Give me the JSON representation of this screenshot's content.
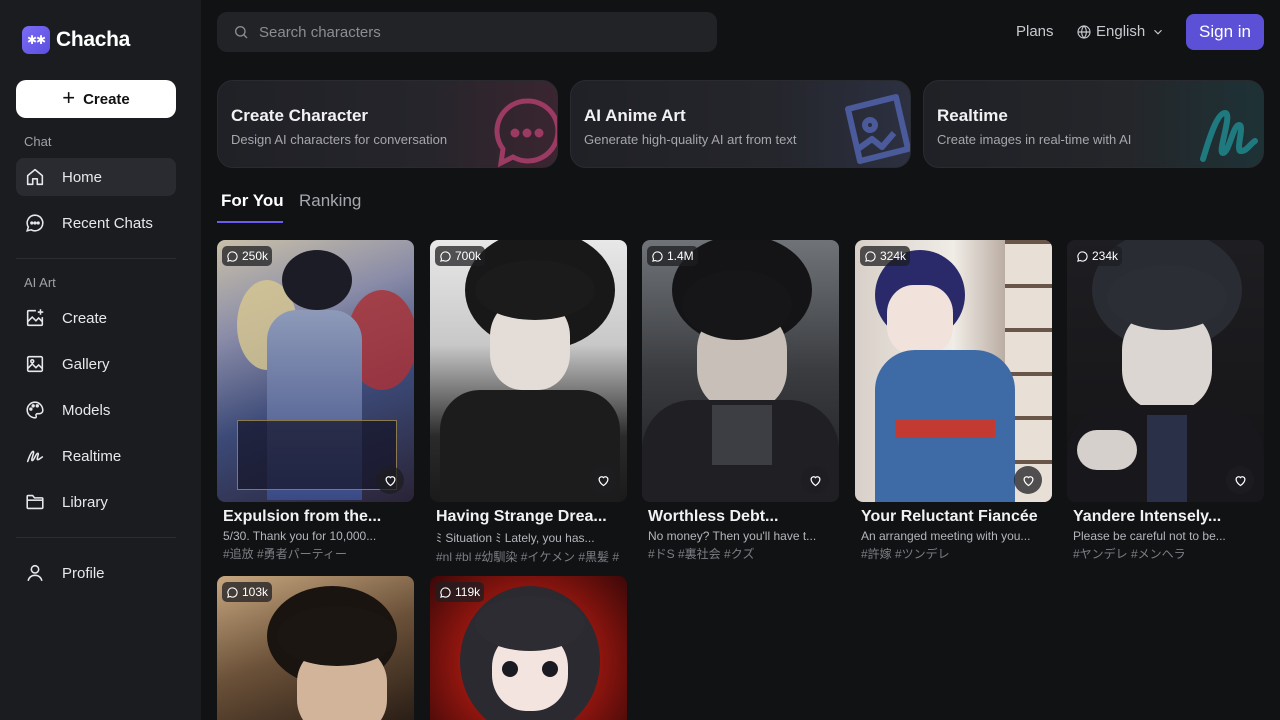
{
  "app": {
    "name": "Chacha",
    "logo_glyph": "✱✱"
  },
  "sidebar": {
    "create_label": "Create",
    "chat_section": "Chat",
    "chat_items": [
      {
        "label": "Home",
        "icon": "home-icon",
        "active": true
      },
      {
        "label": "Recent Chats",
        "icon": "chat-bubble-icon"
      }
    ],
    "art_section": "AI Art",
    "art_items": [
      {
        "label": "Create",
        "icon": "image-plus-icon"
      },
      {
        "label": "Gallery",
        "icon": "image-icon"
      },
      {
        "label": "Models",
        "icon": "palette-icon"
      },
      {
        "label": "Realtime",
        "icon": "squiggle-icon"
      },
      {
        "label": "Library",
        "icon": "folder-icon"
      }
    ],
    "profile_label": "Profile"
  },
  "header": {
    "search_placeholder": "Search characters",
    "plans_label": "Plans",
    "language_label": "English",
    "signin_label": "Sign in"
  },
  "features": [
    {
      "title": "Create Character",
      "subtitle": "Design AI characters for conversation"
    },
    {
      "title": "AI Anime Art",
      "subtitle": "Generate high-quality AI art from text"
    },
    {
      "title": "Realtime",
      "subtitle": "Create images in real-time with AI"
    }
  ],
  "tabs": [
    {
      "label": "For You",
      "active": true
    },
    {
      "label": "Ranking",
      "active": false
    }
  ],
  "cards": [
    {
      "count": "250k",
      "title": "Expulsion from the...",
      "desc": "5/30. Thank you for 10,000...",
      "tags": "#追放 #勇者パーティー"
    },
    {
      "count": "700k",
      "title": "Having Strange Drea...",
      "desc": "ﾐ Situation ﾐ Lately, you has...",
      "tags": "#nl #bl #幼馴染 #イケメン #黒髪 #"
    },
    {
      "count": "1.4M",
      "title": "Worthless Debt...",
      "desc": "No money? Then you'll have t...",
      "tags": "#ドS #裏社会 #クズ"
    },
    {
      "count": "324k",
      "title": "Your Reluctant Fiancée",
      "desc": "An arranged meeting with you...",
      "tags": "#許嫁 #ツンデレ"
    },
    {
      "count": "234k",
      "title": "Yandere Intensely...",
      "desc": "Please be careful not to be...",
      "tags": "#ヤンデレ #メンヘラ"
    },
    {
      "count": "103k",
      "title": "",
      "desc": "",
      "tags": ""
    },
    {
      "count": "119k",
      "title": "",
      "desc": "",
      "tags": ""
    }
  ],
  "colors": {
    "accent": "#5c51d6",
    "tab_underline": "#6b5cf0",
    "background": "#111214",
    "sidebar": "#1b1c20"
  }
}
